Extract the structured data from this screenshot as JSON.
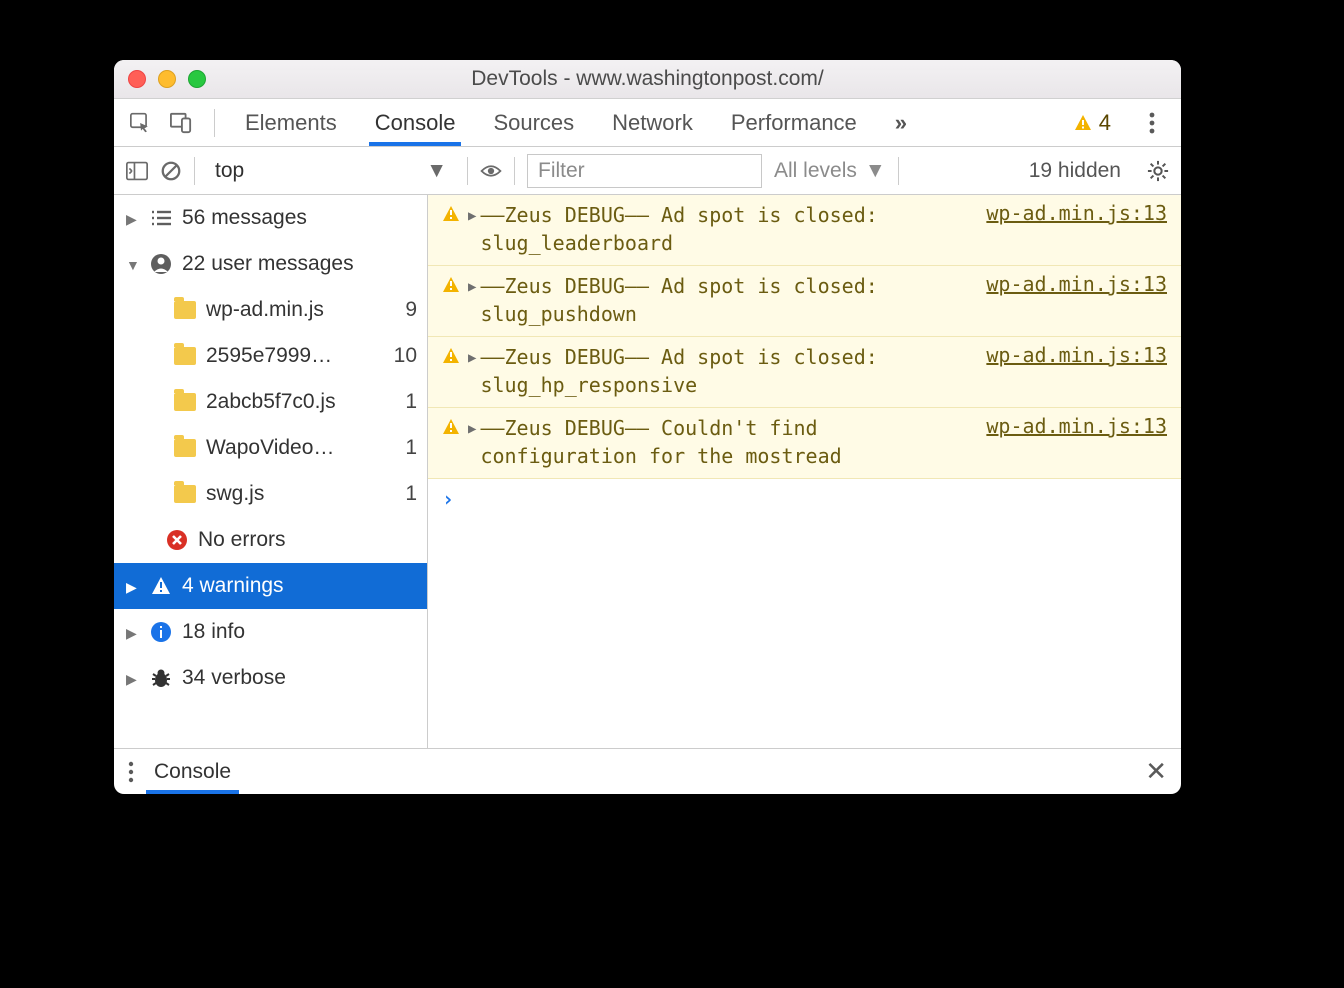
{
  "window": {
    "title": "DevTools - www.washingtonpost.com/"
  },
  "tabs": {
    "items": [
      "Elements",
      "Console",
      "Sources",
      "Network",
      "Performance"
    ],
    "active_index": 1,
    "overflow_glyph": "»",
    "warn_count": "4"
  },
  "toolbar": {
    "context": "top",
    "filter_placeholder": "Filter",
    "levels_label": "All levels",
    "hidden_label": "19 hidden"
  },
  "sidebar": {
    "messages_label": "56 messages",
    "user_messages_label": "22 user messages",
    "files": [
      {
        "name": "wp-ad.min.js",
        "count": "9"
      },
      {
        "name": "2595e7999…",
        "count": "10"
      },
      {
        "name": "2abcb5f7c0.js",
        "count": "1"
      },
      {
        "name": "WapoVideo…",
        "count": "1"
      },
      {
        "name": "swg.js",
        "count": "1"
      }
    ],
    "errors_label": "No errors",
    "warnings_label": "4 warnings",
    "info_label": "18 info",
    "verbose_label": "34 verbose"
  },
  "messages": [
    {
      "text": "––Zeus DEBUG–– Ad spot is closed: slug_leaderboard",
      "source": "wp-ad.min.js:13"
    },
    {
      "text": "––Zeus DEBUG–– Ad spot is closed: slug_pushdown",
      "source": "wp-ad.min.js:13"
    },
    {
      "text": "––Zeus DEBUG–– Ad spot is closed: slug_hp_responsive",
      "source": "wp-ad.min.js:13"
    },
    {
      "text": "––Zeus DEBUG–– Couldn't find configuration for the mostread",
      "source": "wp-ad.min.js:13"
    }
  ],
  "drawer": {
    "tab": "Console"
  }
}
